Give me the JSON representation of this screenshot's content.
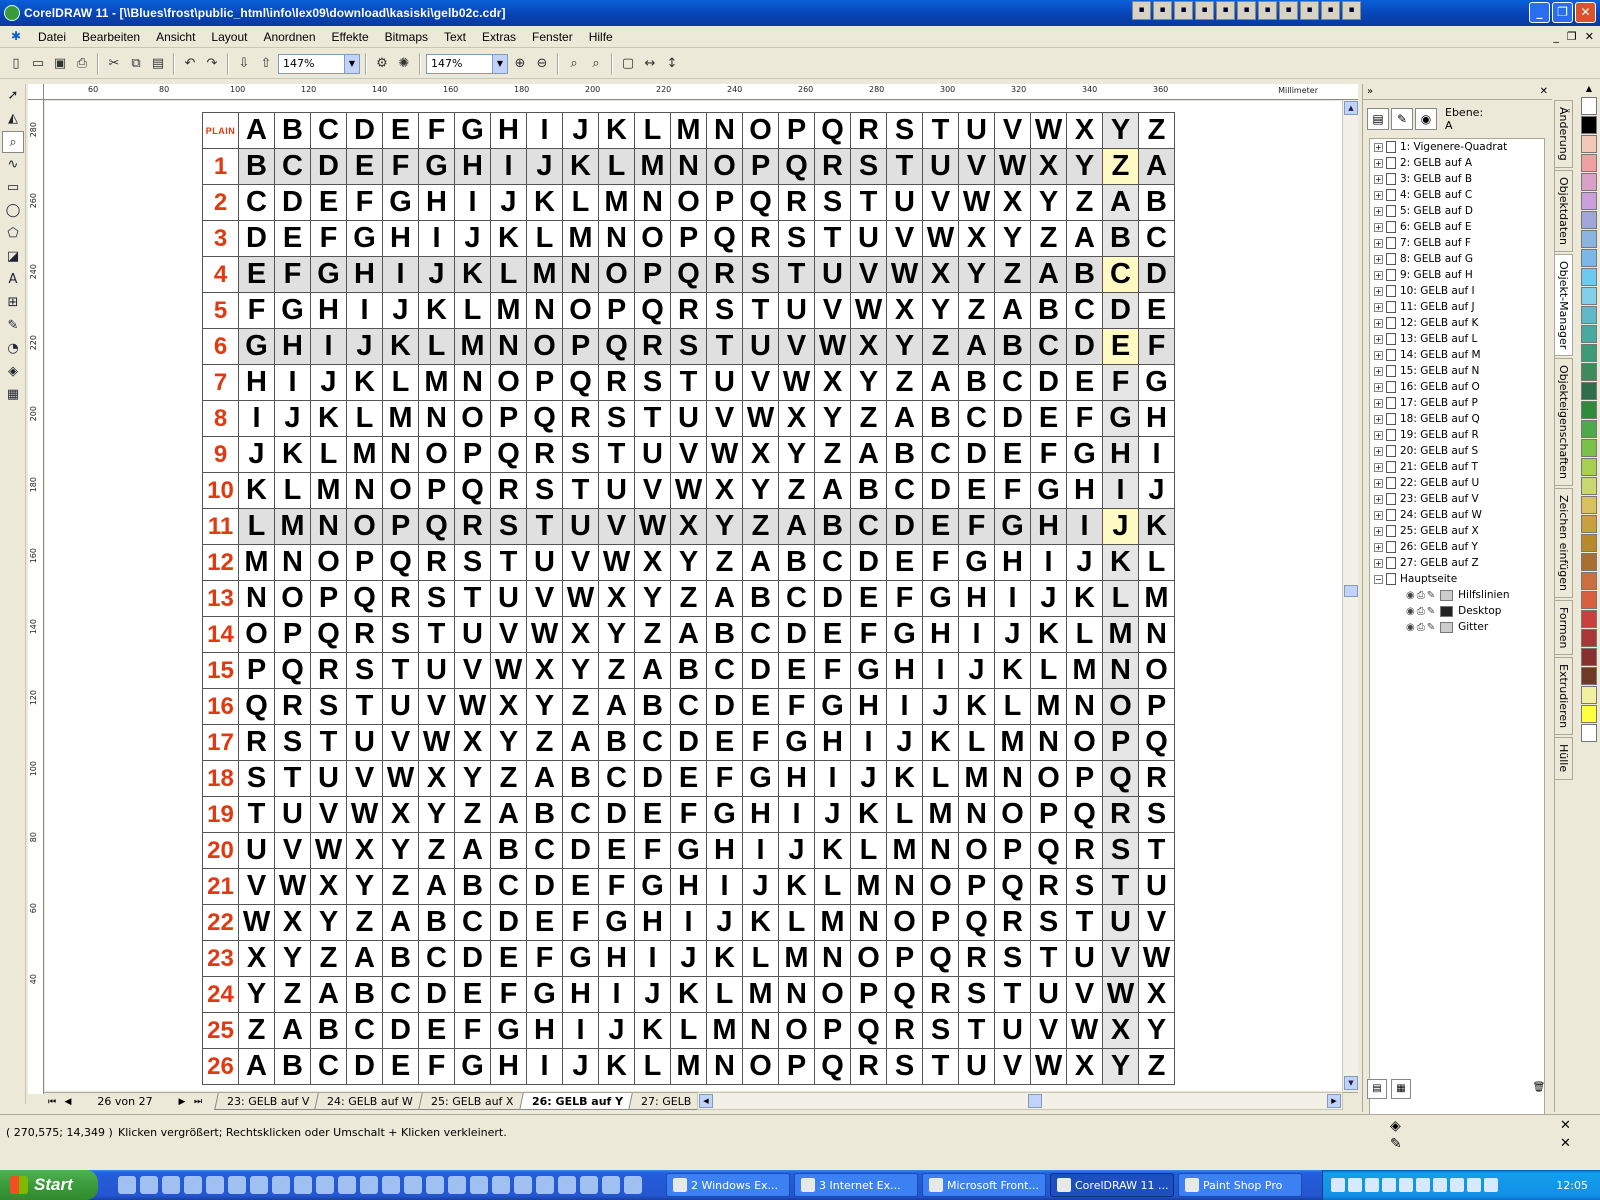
{
  "window": {
    "title": "CorelDRAW 11 - [\\\\Blues\\frost\\public_html\\info\\lex09\\download\\kasiski\\gelb02c.cdr]",
    "tray_icons": [
      "mail-icon",
      "doc-icon",
      "note-icon",
      "grid-icon",
      "word-icon",
      "excel-icon",
      "ppt-icon",
      "app-icon",
      "acrobat-icon",
      "black-icon",
      "monitor-icon"
    ]
  },
  "menu": {
    "items": [
      "Datei",
      "Bearbeiten",
      "Ansicht",
      "Layout",
      "Anordnen",
      "Effekte",
      "Bitmaps",
      "Text",
      "Extras",
      "Fenster",
      "Hilfe"
    ]
  },
  "toolbar": {
    "zoom_left": "147%",
    "zoom_right": "147%"
  },
  "rulers": {
    "unit": "Millimeter",
    "h_ticks": [
      "60",
      "80",
      "100",
      "120",
      "140",
      "160",
      "180",
      "200",
      "220",
      "240",
      "260",
      "280",
      "300",
      "320",
      "340",
      "360"
    ],
    "v_ticks": [
      "280",
      "260",
      "240",
      "220",
      "200",
      "180",
      "160",
      "140",
      "120",
      "100",
      "80",
      "60",
      "40"
    ]
  },
  "vigenere": {
    "header_label": "PLAIN",
    "alphabet": "ABCDEFGHIJKLMNOPQRSTUVWXYZ",
    "highlight_column": "Y",
    "grey_rows": [
      1,
      4,
      6,
      11
    ],
    "row_count": 26
  },
  "page_nav": {
    "count": "26 von 27",
    "tabs": [
      "23: GELB auf V",
      "24: GELB auf W",
      "25: GELB auf X",
      "26: GELB auf Y",
      "27: GELB"
    ],
    "active_tab": "26: GELB auf Y"
  },
  "docker": {
    "layer_label": "Ebene:",
    "layer_value": "A",
    "pages": [
      "1: Vigenere-Quadrat",
      "2: GELB auf A",
      "3: GELB auf B",
      "4: GELB auf C",
      "5: GELB auf D",
      "6: GELB auf E",
      "7: GELB auf F",
      "8: GELB auf G",
      "9: GELB auf H",
      "10: GELB auf I",
      "11: GELB auf J",
      "12: GELB auf K",
      "13: GELB auf L",
      "14: GELB auf M",
      "15: GELB auf N",
      "16: GELB auf O",
      "17: GELB auf P",
      "18: GELB auf Q",
      "19: GELB auf R",
      "20: GELB auf S",
      "21: GELB auf T",
      "22: GELB auf U",
      "23: GELB auf V",
      "24: GELB auf W",
      "25: GELB auf X",
      "26: GELB auf Y",
      "27: GELB auf Z"
    ],
    "master": "Hauptseite",
    "master_layers": [
      {
        "name": "Hilfslinien",
        "color": "#cccccc"
      },
      {
        "name": "Desktop",
        "color": "#222222"
      },
      {
        "name": "Gitter",
        "color": "#cccccc"
      }
    ]
  },
  "docker_tabs": [
    "Änderung",
    "Objektdaten",
    "Objekt-Manager",
    "Objekteigenschaften",
    "Zeichen einfügen",
    "Formen",
    "Extrudieren",
    "Hülle"
  ],
  "palette": [
    "#ffffff",
    "#000000",
    "#f5c7b6",
    "#f0a0a0",
    "#d9a0c8",
    "#c9a0d9",
    "#a0a8d9",
    "#8cb4e0",
    "#7ab8e8",
    "#6ec8f0",
    "#7fd0e8",
    "#5fb8c8",
    "#4aa8a0",
    "#3f9a78",
    "#3d8a5a",
    "#2e6e4a",
    "#2f8a3a",
    "#4fa84a",
    "#7ac04a",
    "#a8d050",
    "#c8d870",
    "#d8c060",
    "#c8a040",
    "#b88a2a",
    "#a87030",
    "#c87040",
    "#d86040",
    "#c84040",
    "#a83838",
    "#883030",
    "#703828",
    "#f0f0a0",
    "#ffff40",
    "#ffffff"
  ],
  "status": {
    "coords": "( 270,575; 14,349 )",
    "hint": "Klicken vergrößert; Rechtsklicken oder Umschalt + Klicken verkleinert."
  },
  "taskbar": {
    "start": "Start",
    "tasks": [
      "2 Windows Ex...",
      "3 Internet Ex...",
      "Microsoft Front...",
      "CorelDRAW 11 ...",
      "Paint Shop Pro"
    ],
    "active_task": "CorelDRAW 11 ...",
    "clock": "12:05"
  }
}
